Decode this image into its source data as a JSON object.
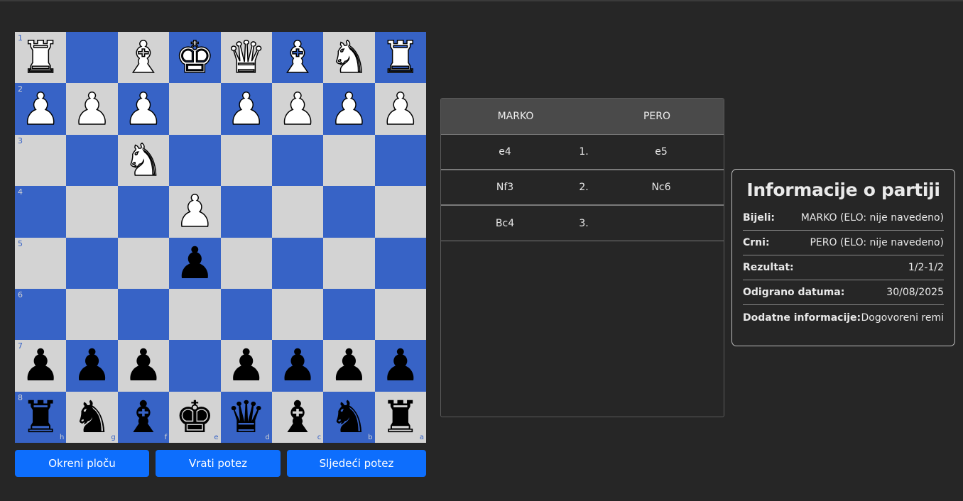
{
  "board": {
    "ranks": [
      "1",
      "2",
      "3",
      "4",
      "5",
      "6",
      "7",
      "8"
    ],
    "files": [
      "h",
      "g",
      "f",
      "e",
      "d",
      "c",
      "b",
      "a"
    ],
    "squares": [
      [
        {
          "p": "♜",
          "c": "white",
          "n": "white-rook-icon"
        },
        {
          "p": "",
          "c": "",
          "n": ""
        },
        {
          "p": "♝",
          "c": "white",
          "n": "white-bishop-icon"
        },
        {
          "p": "♚",
          "c": "white",
          "n": "white-king-icon"
        },
        {
          "p": "♛",
          "c": "white",
          "n": "white-queen-icon"
        },
        {
          "p": "♝",
          "c": "white",
          "n": "white-bishop-icon"
        },
        {
          "p": "♞",
          "c": "white",
          "n": "white-knight-icon"
        },
        {
          "p": "♜",
          "c": "white",
          "n": "white-rook-icon"
        }
      ],
      [
        {
          "p": "♟",
          "c": "white",
          "n": "white-pawn-icon"
        },
        {
          "p": "♟",
          "c": "white",
          "n": "white-pawn-icon"
        },
        {
          "p": "♟",
          "c": "white",
          "n": "white-pawn-icon"
        },
        {
          "p": "",
          "c": "",
          "n": ""
        },
        {
          "p": "♟",
          "c": "white",
          "n": "white-pawn-icon"
        },
        {
          "p": "♟",
          "c": "white",
          "n": "white-pawn-icon"
        },
        {
          "p": "♟",
          "c": "white",
          "n": "white-pawn-icon"
        },
        {
          "p": "♟",
          "c": "white",
          "n": "white-pawn-icon"
        }
      ],
      [
        {
          "p": "",
          "c": "",
          "n": ""
        },
        {
          "p": "",
          "c": "",
          "n": ""
        },
        {
          "p": "♞",
          "c": "white",
          "n": "white-knight-icon"
        },
        {
          "p": "",
          "c": "",
          "n": ""
        },
        {
          "p": "",
          "c": "",
          "n": ""
        },
        {
          "p": "",
          "c": "",
          "n": ""
        },
        {
          "p": "",
          "c": "",
          "n": ""
        },
        {
          "p": "",
          "c": "",
          "n": ""
        }
      ],
      [
        {
          "p": "",
          "c": "",
          "n": ""
        },
        {
          "p": "",
          "c": "",
          "n": ""
        },
        {
          "p": "",
          "c": "",
          "n": ""
        },
        {
          "p": "♟",
          "c": "white",
          "n": "white-pawn-icon"
        },
        {
          "p": "",
          "c": "",
          "n": ""
        },
        {
          "p": "",
          "c": "",
          "n": ""
        },
        {
          "p": "",
          "c": "",
          "n": ""
        },
        {
          "p": "",
          "c": "",
          "n": ""
        }
      ],
      [
        {
          "p": "",
          "c": "",
          "n": ""
        },
        {
          "p": "",
          "c": "",
          "n": ""
        },
        {
          "p": "",
          "c": "",
          "n": ""
        },
        {
          "p": "♟",
          "c": "black",
          "n": "black-pawn-icon"
        },
        {
          "p": "",
          "c": "",
          "n": ""
        },
        {
          "p": "",
          "c": "",
          "n": ""
        },
        {
          "p": "",
          "c": "",
          "n": ""
        },
        {
          "p": "",
          "c": "",
          "n": ""
        }
      ],
      [
        {
          "p": "",
          "c": "",
          "n": ""
        },
        {
          "p": "",
          "c": "",
          "n": ""
        },
        {
          "p": "",
          "c": "",
          "n": ""
        },
        {
          "p": "",
          "c": "",
          "n": ""
        },
        {
          "p": "",
          "c": "",
          "n": ""
        },
        {
          "p": "",
          "c": "",
          "n": ""
        },
        {
          "p": "",
          "c": "",
          "n": ""
        },
        {
          "p": "",
          "c": "",
          "n": ""
        }
      ],
      [
        {
          "p": "♟",
          "c": "black",
          "n": "black-pawn-icon"
        },
        {
          "p": "♟",
          "c": "black",
          "n": "black-pawn-icon"
        },
        {
          "p": "♟",
          "c": "black",
          "n": "black-pawn-icon"
        },
        {
          "p": "",
          "c": "",
          "n": ""
        },
        {
          "p": "♟",
          "c": "black",
          "n": "black-pawn-icon"
        },
        {
          "p": "♟",
          "c": "black",
          "n": "black-pawn-icon"
        },
        {
          "p": "♟",
          "c": "black",
          "n": "black-pawn-icon"
        },
        {
          "p": "♟",
          "c": "black",
          "n": "black-pawn-icon"
        }
      ],
      [
        {
          "p": "♜",
          "c": "black",
          "n": "black-rook-icon"
        },
        {
          "p": "♞",
          "c": "black",
          "n": "black-knight-icon"
        },
        {
          "p": "♝",
          "c": "black",
          "n": "black-bishop-icon"
        },
        {
          "p": "♚",
          "c": "black",
          "n": "black-king-icon"
        },
        {
          "p": "♛",
          "c": "black",
          "n": "black-queen-icon"
        },
        {
          "p": "♝",
          "c": "black",
          "n": "black-bishop-icon"
        },
        {
          "p": "♞",
          "c": "black",
          "n": "black-knight-icon"
        },
        {
          "p": "♜",
          "c": "black",
          "n": "black-rook-icon"
        }
      ]
    ],
    "colors": {
      "light": "#d3d3d3",
      "dark": "#3763c6"
    }
  },
  "buttons": {
    "flip": "Okreni ploču",
    "undo": "Vrati potez",
    "next": "Sljedeći potez",
    "color": "#0d6efd"
  },
  "moves": {
    "white_player": "MARKO",
    "black_player": "PERO",
    "rows": [
      {
        "num": "1.",
        "white": "e4",
        "black": "e5"
      },
      {
        "num": "2.",
        "white": "Nf3",
        "black": "Nc6"
      },
      {
        "num": "3.",
        "white": "Bc4",
        "black": ""
      }
    ]
  },
  "info": {
    "title": "Informacije o partiji",
    "rows": [
      {
        "key": "Bijeli:",
        "value": "MARKO (ELO: nije navedeno)"
      },
      {
        "key": "Crni:",
        "value": "PERO (ELO: nije navedeno)"
      },
      {
        "key": "Rezultat:",
        "value": "1/2-1/2"
      },
      {
        "key": "Odigrano datuma:",
        "value": "30/08/2025"
      },
      {
        "key": "Dodatne informacije:",
        "value": "Dogovoreni remi"
      }
    ]
  }
}
